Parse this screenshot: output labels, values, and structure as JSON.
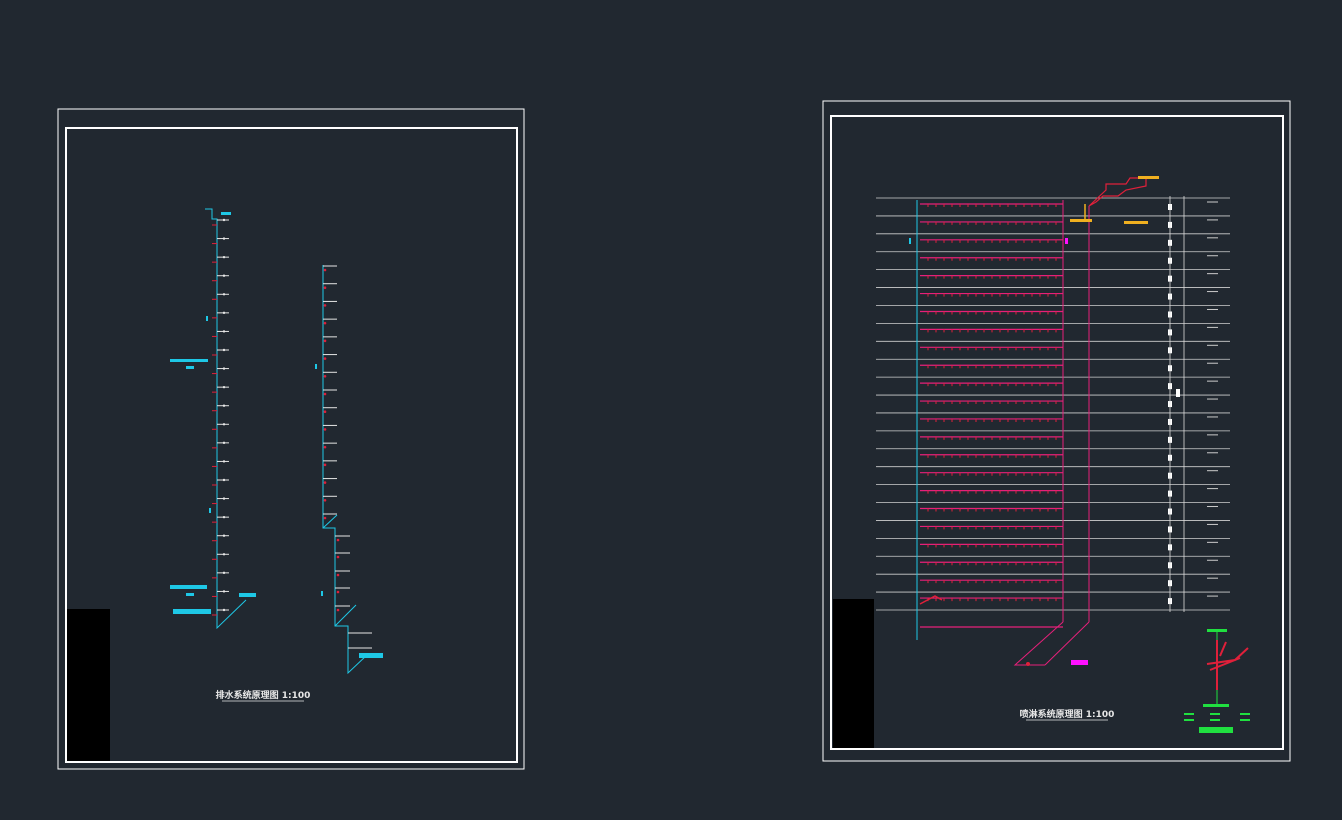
{
  "colors": {
    "background": "#212830",
    "frame": "#ffffff",
    "drain_pipe": "#1ec8e6",
    "sprinkler_pipe": "#e6207a",
    "branch_red": "#e0203a",
    "alarm_valve": "#20e040",
    "tag_yellow": "#f0b020",
    "tag_magenta": "#ff10ff"
  },
  "left_sheet": {
    "title": "排水系统原理图 1:100",
    "floors_main": 22,
    "floors_secondary": 15
  },
  "right_sheet": {
    "title": "喷淋系统原理图 1:100",
    "floors": 24
  }
}
